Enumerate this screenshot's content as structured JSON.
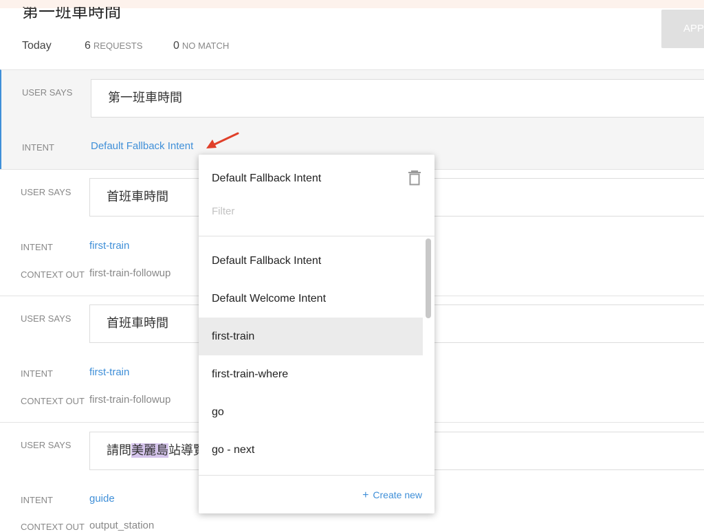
{
  "page": {
    "title": "第一班車時間",
    "stats": [
      {
        "num": "",
        "label": "Today"
      },
      {
        "num": "6",
        "label": "REQUESTS"
      },
      {
        "num": "0",
        "label": "NO MATCH"
      }
    ],
    "approve_label": "APP"
  },
  "labels": {
    "user_says": "USER SAYS",
    "intent": "INTENT",
    "context_out": "CONTEXT OUT"
  },
  "rows": [
    {
      "says": "第一班車時間",
      "intent": "Default Fallback Intent",
      "context": ""
    },
    {
      "says": "首班車時間",
      "intent": "first-train",
      "context": "first-train-followup"
    },
    {
      "says": "首班車時間",
      "intent": "first-train",
      "context": "first-train-followup"
    },
    {
      "says_pre": "請問",
      "says_hl": "美麗島",
      "says_post": "站導覽",
      "intent": "guide",
      "context": "output_station"
    }
  ],
  "dropdown": {
    "selected": "Default Fallback Intent",
    "filter_placeholder": "Filter",
    "items": [
      "Default Fallback Intent",
      "Default Welcome Intent",
      "first-train",
      "first-train-where",
      "go",
      "go - next"
    ],
    "hovered_index": 2,
    "create_new": "Create new",
    "create_new_icon": "plus-icon"
  },
  "colors": {
    "accent": "#3f8fd8",
    "arrow": "#e0402a",
    "highlight": "#d5c4ec"
  }
}
